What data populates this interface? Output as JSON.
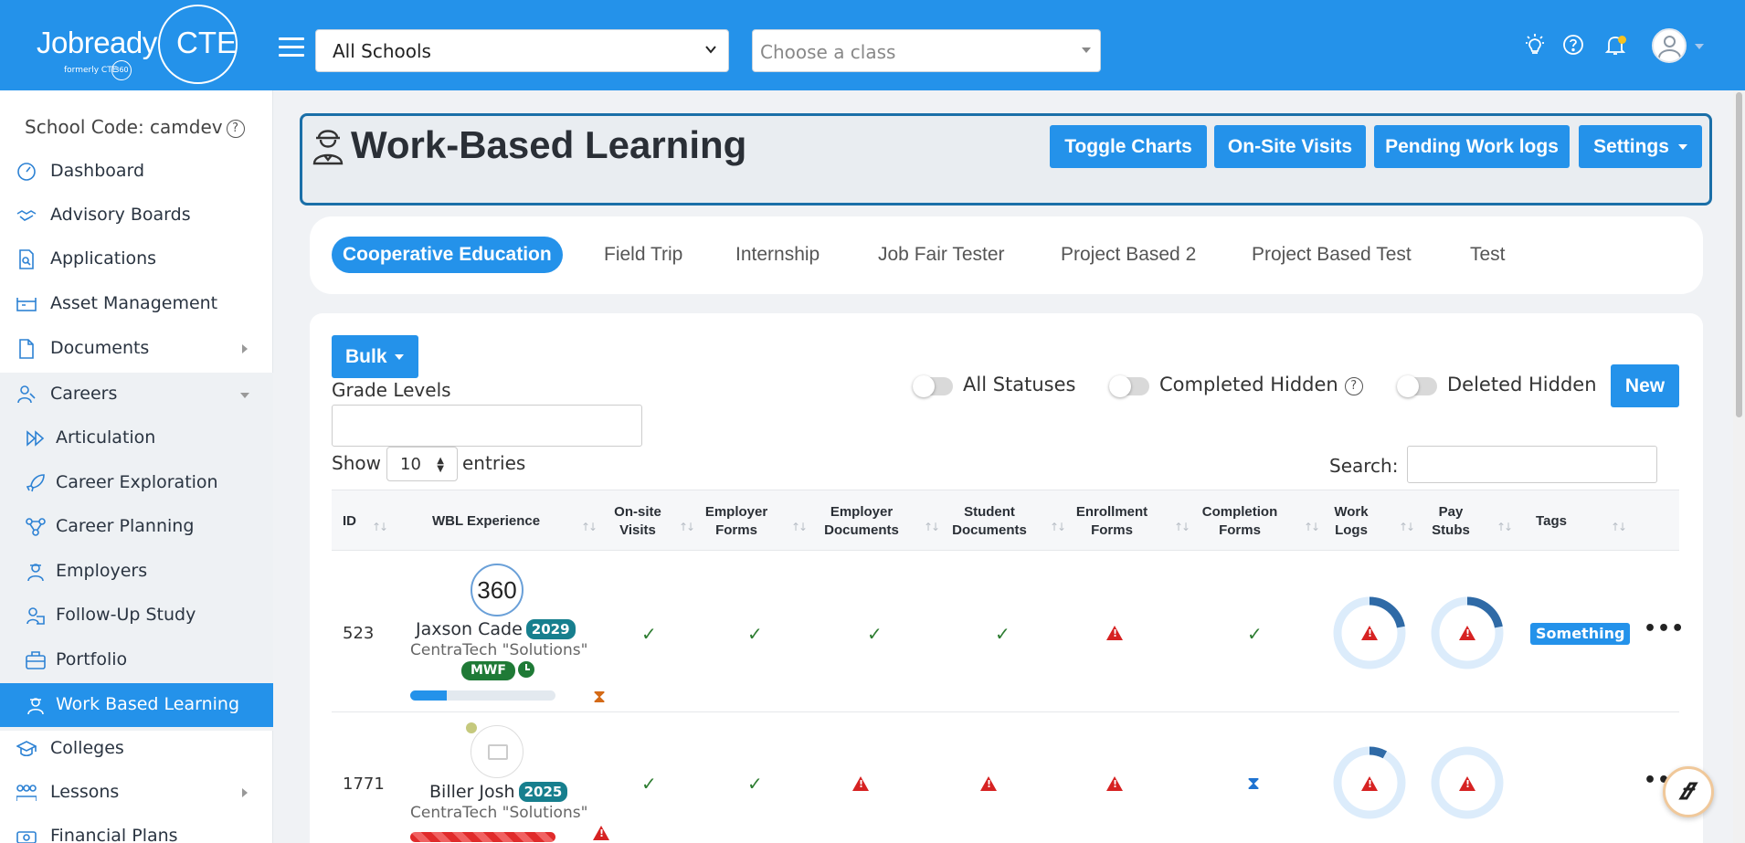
{
  "brand": {
    "name": "Jobready",
    "suffix": "CTE",
    "formerly": "formerly CTE",
    "mini": "360"
  },
  "header": {
    "school_select": "All Schools",
    "class_placeholder": "Choose a class"
  },
  "sidebar": {
    "school_code_label": "School Code: camdev",
    "items": [
      {
        "label": "Dashboard",
        "icon": "dashboard-icon"
      },
      {
        "label": "Advisory Boards",
        "icon": "handshake-icon"
      },
      {
        "label": "Applications",
        "icon": "application-search-icon"
      },
      {
        "label": "Asset Management",
        "icon": "asset-icon"
      },
      {
        "label": "Documents",
        "icon": "document-icon"
      },
      {
        "label": "Careers",
        "icon": "careers-icon"
      },
      {
        "label": "Articulation",
        "icon": "forward-icon"
      },
      {
        "label": "Career Exploration",
        "icon": "rocket-icon"
      },
      {
        "label": "Career Planning",
        "icon": "route-icon"
      },
      {
        "label": "Employers",
        "icon": "employer-icon"
      },
      {
        "label": "Follow-Up Study",
        "icon": "study-icon"
      },
      {
        "label": "Portfolio",
        "icon": "briefcase-icon"
      },
      {
        "label": "Work Based Learning",
        "icon": "worker-icon"
      },
      {
        "label": "Colleges",
        "icon": "graduation-cap-icon"
      },
      {
        "label": "Lessons",
        "icon": "group-icon"
      },
      {
        "label": "Financial Plans",
        "icon": "money-icon"
      }
    ]
  },
  "page": {
    "title": "Work-Based Learning",
    "buttons": {
      "toggle_charts": "Toggle Charts",
      "onsite_visits": "On-Site Visits",
      "pending_work_logs": "Pending Work logs",
      "settings": "Settings"
    }
  },
  "tabs": [
    "Cooperative Education",
    "Field Trip",
    "Internship",
    "Job Fair Tester",
    "Project Based 2",
    "Project Based Test",
    "Test"
  ],
  "controls": {
    "bulk": "Bulk",
    "grade_levels": "Grade Levels",
    "all_statuses": "All Statuses",
    "completed_hidden": "Completed Hidden",
    "deleted_hidden": "Deleted Hidden",
    "new": "New",
    "show": "Show",
    "entries_value": "10",
    "entries": "entries",
    "search": "Search:"
  },
  "table": {
    "columns": [
      "ID",
      "WBL Experience",
      "On-site Visits",
      "Employer Forms",
      "Employer Documents",
      "Student Documents",
      "Enrollment Forms",
      "Completion Forms",
      "Work Logs",
      "Pay Stubs",
      "Tags"
    ],
    "rows": [
      {
        "id": "523",
        "pic_text": "360",
        "name": "Jaxson Cade",
        "year": "2029",
        "company": "CentraTech \"Solutions\"",
        "schedule": "MWF",
        "progress": 0.25,
        "tag": "Something",
        "work_logs_pct": 0.22,
        "pay_stubs_pct": 0.22
      },
      {
        "id": "1771",
        "name": "Biller Josh",
        "year": "2025",
        "company": "CentraTech \"Solutions\"",
        "progress": 1.0,
        "work_logs_pct": 0.08,
        "pay_stubs_pct": 0.0
      }
    ]
  },
  "colors": {
    "primary": "#2492ea",
    "header_border": "#1a6fa8",
    "success": "#2e7d32",
    "danger": "#d62222",
    "donut_track": "#dcecfb",
    "donut_fill": "#2f6aa6"
  }
}
